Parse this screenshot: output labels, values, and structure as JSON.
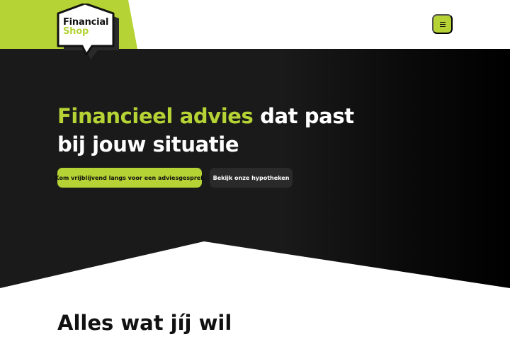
{
  "header": {
    "logo": {
      "line1": "Financial",
      "line2": "Shop"
    },
    "menu_icon": "hamburger-menu-icon"
  },
  "hero": {
    "title_highlight": "Financieel advies",
    "title_rest": " dat past bij jouw situatie",
    "primary_button": "Kom vrijblijvend langs voor een adviesgesprek",
    "secondary_button": "Bekijk onze hypotheken"
  },
  "next_section": {
    "heading": "Alles wat jíj wil"
  },
  "colors": {
    "accent": "#b5d334",
    "dark": "#1a1a1a",
    "text_light": "#ffffff",
    "text_dark": "#111111"
  }
}
